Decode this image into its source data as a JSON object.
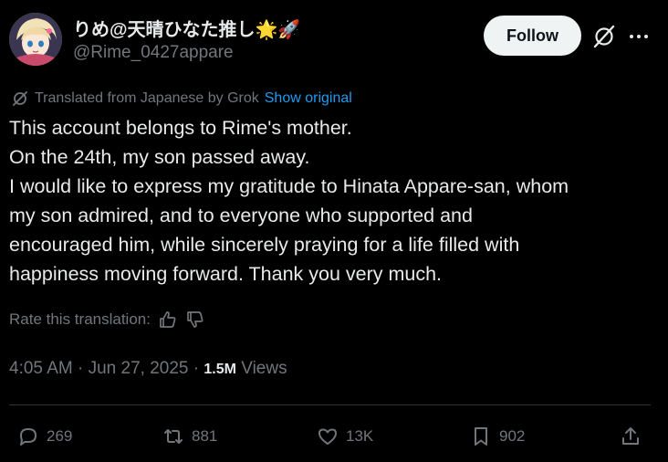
{
  "author": {
    "display_name": "りめ@天晴ひなた推し🌟🚀",
    "handle": "@Rime_0427appare",
    "follow_label": "Follow"
  },
  "translation": {
    "note": "Translated from Japanese by Grok",
    "show_original": "Show original"
  },
  "post": {
    "lines": [
      "This account belongs to Rime's mother.",
      "On the 24th, my son passed away.",
      "I would like to express my gratitude to Hinata Appare-san, whom",
      "my son admired, and to everyone who supported and",
      "encouraged him, while sincerely praying for a life filled with",
      "happiness moving forward. Thank you very much."
    ],
    "rate_label": "Rate this translation:"
  },
  "meta": {
    "time": "4:05 AM",
    "date": "Jun 27, 2025",
    "views_count": "1.5M",
    "views_label": "Views"
  },
  "actions": {
    "replies": "269",
    "reposts": "881",
    "likes": "13K",
    "bookmarks": "902"
  },
  "colors": {
    "background": "#000000",
    "text": "#e7e9ea",
    "muted": "#71767b",
    "link": "#1d9bf0",
    "follow_bg": "#eff3f4"
  }
}
